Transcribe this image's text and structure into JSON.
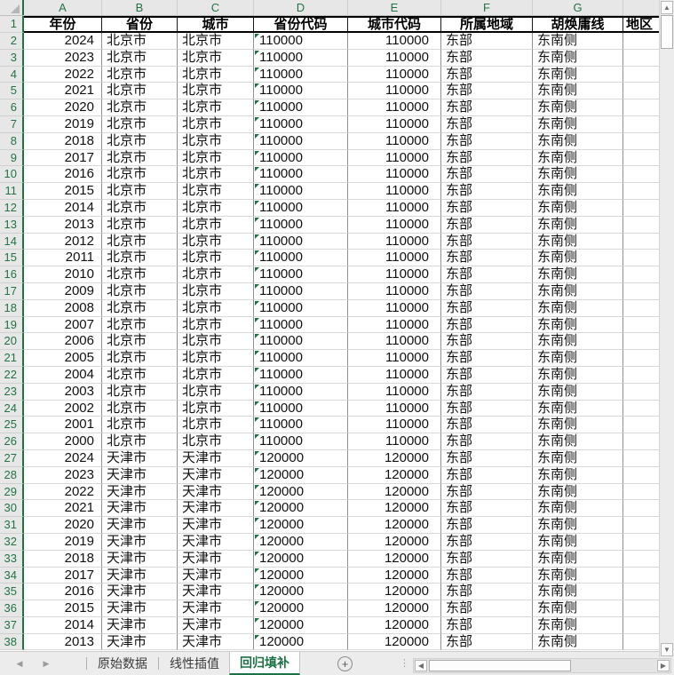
{
  "columns": {
    "letters": [
      "A",
      "B",
      "C",
      "D",
      "E",
      "F",
      "G"
    ],
    "header_cells": [
      "年份",
      "省份",
      "城市",
      "省份代码",
      "城市代码",
      "所属地域",
      "胡焕庸线",
      "地区"
    ]
  },
  "header_row_number": "1",
  "rows": [
    {
      "n": "2",
      "year": "2024",
      "province": "北京市",
      "city": "北京市",
      "prov_code": "110000",
      "city_code": "110000",
      "region": "东部",
      "hu_line": "东南侧"
    },
    {
      "n": "3",
      "year": "2023",
      "province": "北京市",
      "city": "北京市",
      "prov_code": "110000",
      "city_code": "110000",
      "region": "东部",
      "hu_line": "东南侧"
    },
    {
      "n": "4",
      "year": "2022",
      "province": "北京市",
      "city": "北京市",
      "prov_code": "110000",
      "city_code": "110000",
      "region": "东部",
      "hu_line": "东南侧"
    },
    {
      "n": "5",
      "year": "2021",
      "province": "北京市",
      "city": "北京市",
      "prov_code": "110000",
      "city_code": "110000",
      "region": "东部",
      "hu_line": "东南侧"
    },
    {
      "n": "6",
      "year": "2020",
      "province": "北京市",
      "city": "北京市",
      "prov_code": "110000",
      "city_code": "110000",
      "region": "东部",
      "hu_line": "东南侧"
    },
    {
      "n": "7",
      "year": "2019",
      "province": "北京市",
      "city": "北京市",
      "prov_code": "110000",
      "city_code": "110000",
      "region": "东部",
      "hu_line": "东南侧"
    },
    {
      "n": "8",
      "year": "2018",
      "province": "北京市",
      "city": "北京市",
      "prov_code": "110000",
      "city_code": "110000",
      "region": "东部",
      "hu_line": "东南侧"
    },
    {
      "n": "9",
      "year": "2017",
      "province": "北京市",
      "city": "北京市",
      "prov_code": "110000",
      "city_code": "110000",
      "region": "东部",
      "hu_line": "东南侧"
    },
    {
      "n": "10",
      "year": "2016",
      "province": "北京市",
      "city": "北京市",
      "prov_code": "110000",
      "city_code": "110000",
      "region": "东部",
      "hu_line": "东南侧"
    },
    {
      "n": "11",
      "year": "2015",
      "province": "北京市",
      "city": "北京市",
      "prov_code": "110000",
      "city_code": "110000",
      "region": "东部",
      "hu_line": "东南侧"
    },
    {
      "n": "12",
      "year": "2014",
      "province": "北京市",
      "city": "北京市",
      "prov_code": "110000",
      "city_code": "110000",
      "region": "东部",
      "hu_line": "东南侧"
    },
    {
      "n": "13",
      "year": "2013",
      "province": "北京市",
      "city": "北京市",
      "prov_code": "110000",
      "city_code": "110000",
      "region": "东部",
      "hu_line": "东南侧"
    },
    {
      "n": "14",
      "year": "2012",
      "province": "北京市",
      "city": "北京市",
      "prov_code": "110000",
      "city_code": "110000",
      "region": "东部",
      "hu_line": "东南侧"
    },
    {
      "n": "15",
      "year": "2011",
      "province": "北京市",
      "city": "北京市",
      "prov_code": "110000",
      "city_code": "110000",
      "region": "东部",
      "hu_line": "东南侧"
    },
    {
      "n": "16",
      "year": "2010",
      "province": "北京市",
      "city": "北京市",
      "prov_code": "110000",
      "city_code": "110000",
      "region": "东部",
      "hu_line": "东南侧"
    },
    {
      "n": "17",
      "year": "2009",
      "province": "北京市",
      "city": "北京市",
      "prov_code": "110000",
      "city_code": "110000",
      "region": "东部",
      "hu_line": "东南侧"
    },
    {
      "n": "18",
      "year": "2008",
      "province": "北京市",
      "city": "北京市",
      "prov_code": "110000",
      "city_code": "110000",
      "region": "东部",
      "hu_line": "东南侧"
    },
    {
      "n": "19",
      "year": "2007",
      "province": "北京市",
      "city": "北京市",
      "prov_code": "110000",
      "city_code": "110000",
      "region": "东部",
      "hu_line": "东南侧"
    },
    {
      "n": "20",
      "year": "2006",
      "province": "北京市",
      "city": "北京市",
      "prov_code": "110000",
      "city_code": "110000",
      "region": "东部",
      "hu_line": "东南侧"
    },
    {
      "n": "21",
      "year": "2005",
      "province": "北京市",
      "city": "北京市",
      "prov_code": "110000",
      "city_code": "110000",
      "region": "东部",
      "hu_line": "东南侧"
    },
    {
      "n": "22",
      "year": "2004",
      "province": "北京市",
      "city": "北京市",
      "prov_code": "110000",
      "city_code": "110000",
      "region": "东部",
      "hu_line": "东南侧"
    },
    {
      "n": "23",
      "year": "2003",
      "province": "北京市",
      "city": "北京市",
      "prov_code": "110000",
      "city_code": "110000",
      "region": "东部",
      "hu_line": "东南侧"
    },
    {
      "n": "24",
      "year": "2002",
      "province": "北京市",
      "city": "北京市",
      "prov_code": "110000",
      "city_code": "110000",
      "region": "东部",
      "hu_line": "东南侧"
    },
    {
      "n": "25",
      "year": "2001",
      "province": "北京市",
      "city": "北京市",
      "prov_code": "110000",
      "city_code": "110000",
      "region": "东部",
      "hu_line": "东南侧"
    },
    {
      "n": "26",
      "year": "2000",
      "province": "北京市",
      "city": "北京市",
      "prov_code": "110000",
      "city_code": "110000",
      "region": "东部",
      "hu_line": "东南侧"
    },
    {
      "n": "27",
      "year": "2024",
      "province": "天津市",
      "city": "天津市",
      "prov_code": "120000",
      "city_code": "120000",
      "region": "东部",
      "hu_line": "东南侧"
    },
    {
      "n": "28",
      "year": "2023",
      "province": "天津市",
      "city": "天津市",
      "prov_code": "120000",
      "city_code": "120000",
      "region": "东部",
      "hu_line": "东南侧"
    },
    {
      "n": "29",
      "year": "2022",
      "province": "天津市",
      "city": "天津市",
      "prov_code": "120000",
      "city_code": "120000",
      "region": "东部",
      "hu_line": "东南侧"
    },
    {
      "n": "30",
      "year": "2021",
      "province": "天津市",
      "city": "天津市",
      "prov_code": "120000",
      "city_code": "120000",
      "region": "东部",
      "hu_line": "东南侧"
    },
    {
      "n": "31",
      "year": "2020",
      "province": "天津市",
      "city": "天津市",
      "prov_code": "120000",
      "city_code": "120000",
      "region": "东部",
      "hu_line": "东南侧"
    },
    {
      "n": "32",
      "year": "2019",
      "province": "天津市",
      "city": "天津市",
      "prov_code": "120000",
      "city_code": "120000",
      "region": "东部",
      "hu_line": "东南侧"
    },
    {
      "n": "33",
      "year": "2018",
      "province": "天津市",
      "city": "天津市",
      "prov_code": "120000",
      "city_code": "120000",
      "region": "东部",
      "hu_line": "东南侧"
    },
    {
      "n": "34",
      "year": "2017",
      "province": "天津市",
      "city": "天津市",
      "prov_code": "120000",
      "city_code": "120000",
      "region": "东部",
      "hu_line": "东南侧"
    },
    {
      "n": "35",
      "year": "2016",
      "province": "天津市",
      "city": "天津市",
      "prov_code": "120000",
      "city_code": "120000",
      "region": "东部",
      "hu_line": "东南侧"
    },
    {
      "n": "36",
      "year": "2015",
      "province": "天津市",
      "city": "天津市",
      "prov_code": "120000",
      "city_code": "120000",
      "region": "东部",
      "hu_line": "东南侧"
    },
    {
      "n": "37",
      "year": "2014",
      "province": "天津市",
      "city": "天津市",
      "prov_code": "120000",
      "city_code": "120000",
      "region": "东部",
      "hu_line": "东南侧"
    },
    {
      "n": "38",
      "year": "2013",
      "province": "天津市",
      "city": "天津市",
      "prov_code": "120000",
      "city_code": "120000",
      "region": "东部",
      "hu_line": "东南侧"
    }
  ],
  "tabbar": {
    "tabs": [
      {
        "label": "原始数据"
      },
      {
        "label": "线性插值"
      },
      {
        "label": "回归填补"
      }
    ],
    "active_tab": "回归填补"
  },
  "icons": {
    "tab_prev": "◀",
    "tab_next": "▶",
    "scroll_up": "▲",
    "scroll_down": "▼",
    "scroll_left": "◀",
    "scroll_right": "▶",
    "add_sheet": "+",
    "tab_resize": "⋮"
  },
  "colors": {
    "accent_green": "#217346",
    "indicator_green": "#1e7145",
    "header_bg": "#e7e7e7",
    "tabbar_bg": "#ececec"
  }
}
